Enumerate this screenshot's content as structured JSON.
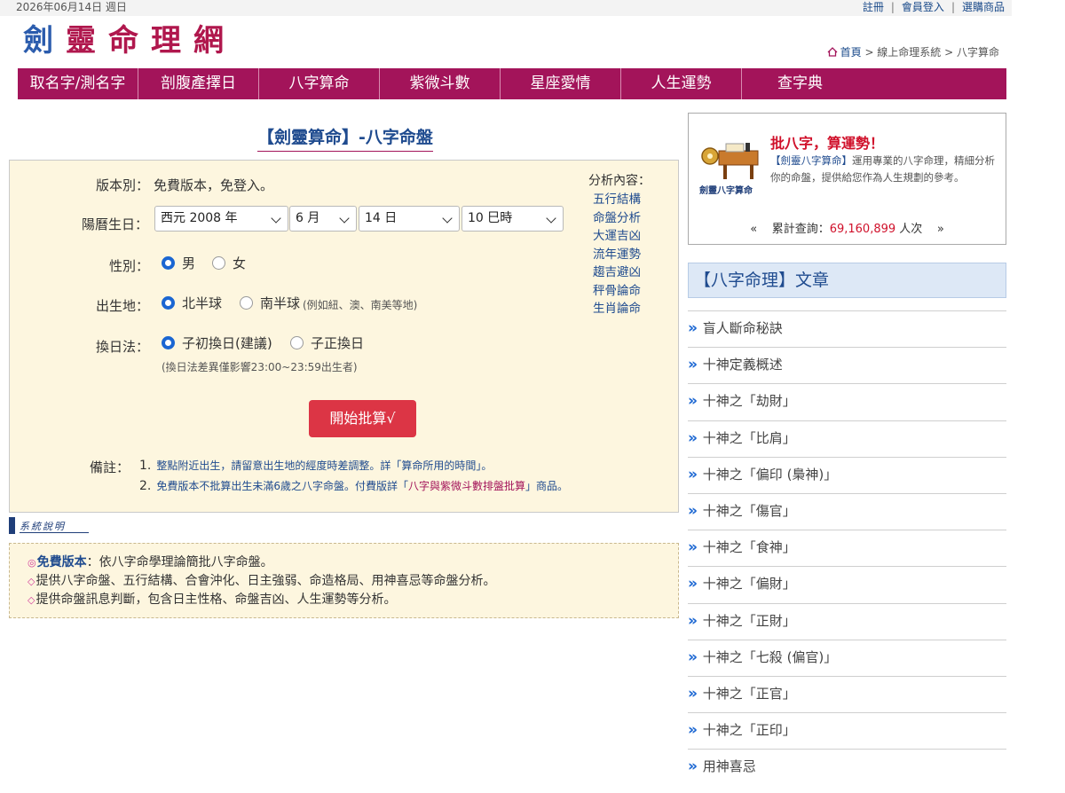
{
  "topbar": {
    "date": "2026年06月14日 週日",
    "links": [
      "註冊",
      "會員登入",
      "選購商品"
    ]
  },
  "logo": {
    "chars": [
      "劍",
      "靈",
      "命",
      "理",
      "網"
    ]
  },
  "breadcrumb": {
    "home": "首頁",
    "rest": " > 線上命理系統 > 八字算命"
  },
  "nav": [
    "取名字/測名字",
    "剖腹產擇日",
    "八字算命",
    "紫微斗數",
    "星座愛情",
    "人生運勢",
    "查字典"
  ],
  "title": "【劍靈算命】-八字命盤",
  "form": {
    "version_label": "版本別：",
    "version_value": "免費版本，免登入。",
    "birthday_label": "陽曆生日：",
    "year": "西元 2008 年",
    "month": "6 月",
    "day": "14 日",
    "hour": "10 巳時",
    "gender_label": "性別：",
    "gender_options": [
      "男",
      "女"
    ],
    "gender_selected": "男",
    "birthplace_label": "出生地：",
    "birthplace_options": [
      "北半球",
      "南半球"
    ],
    "birthplace_note": "(例如紐、澳、南美等地)",
    "birthplace_selected": "北半球",
    "day_change_label": "換日法：",
    "day_change_options": [
      "子初換日(建議)",
      "子正換日"
    ],
    "day_change_selected": "子初換日(建議)",
    "day_change_note": "(換日法差異僅影響23:00~23:59出生者)",
    "submit": "開始批算√",
    "analysis_title": "分析內容：",
    "analysis_items": [
      "五行結構",
      "命盤分析",
      "大運吉凶",
      "流年運勢",
      "趨吉避凶",
      "秤骨論命",
      "生肖論命"
    ],
    "notes_label": "備註：",
    "note1_num": "1.",
    "note1_pre": "整點附近出生，請留意出生地的經度時差調整。詳「",
    "note1_link": "算命所用的時間",
    "note1_post": "」。",
    "note2_num": "2.",
    "note2_pre": "免費版本不批算出生未滿6歲之八字命盤。付費版詳「",
    "note2_link": "八字與紫微斗數排盤批算",
    "note2_post": "」商品。"
  },
  "system": {
    "header": "系統說明",
    "line1_em": "免費版本",
    "line1_rest": "：依八字命學理論簡批八字命盤。",
    "line2": "提供八字命盤、五行結構、合會沖化、日主強弱、命造格局、用神喜忌等命盤分析。",
    "line3": "提供命盤訊息判斷，包含日主性格、命盤吉凶、人生運勢等分析。"
  },
  "promo": {
    "brand": "劍靈八字算命",
    "headline": "批八字，算運勢！",
    "desc_hl": "【劍靈八字算命】",
    "desc_rest": "運用專業的八字命理，精細分析你的命盤，提供給您作為人生規劃的參考。",
    "counter_label": "累計查詢：",
    "counter_value": "69,160,899",
    "counter_unit": " 人次"
  },
  "articles_head": "【八字命理】文章",
  "articles": [
    "盲人斷命秘訣",
    "十神定義概述",
    "十神之「劫財」",
    "十神之「比肩」",
    "十神之「偏印 (梟神)」",
    "十神之「傷官」",
    "十神之「食神」",
    "十神之「偏財」",
    "十神之「正財」",
    "十神之「七殺 (偏官)」",
    "十神之「正官」",
    "十神之「正印」",
    "用神喜忌"
  ]
}
